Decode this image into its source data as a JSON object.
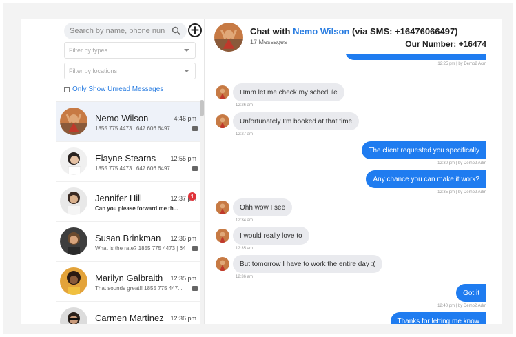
{
  "search": {
    "placeholder": "Search by name, phone nun"
  },
  "filters": {
    "types_placeholder": "Filter by types",
    "locations_placeholder": "Filter by locations"
  },
  "unread_label": "Only Show Unread Messages",
  "contacts": [
    {
      "name": "Nemo Wilson",
      "time": "4:46 pm",
      "sub": "1855 775 4473 | 647 606 6497",
      "bold": false,
      "badge": ""
    },
    {
      "name": "Elayne Stearns",
      "time": "12:55 pm",
      "sub": "1855 775 4473 | 647 606 6497",
      "bold": false,
      "badge": ""
    },
    {
      "name": "Jennifer Hill",
      "time": "12:37 pm",
      "sub": "Can you please forward me th...",
      "bold": true,
      "badge": "1"
    },
    {
      "name": "Susan Brinkman",
      "time": "12:36 pm",
      "sub": "What is the rate? 1855 775 4473 | 64",
      "bold": false,
      "badge": ""
    },
    {
      "name": "Marilyn Galbraith",
      "time": "12:35 pm",
      "sub": "That sounds great!! 1855 775 447...",
      "bold": false,
      "badge": ""
    },
    {
      "name": "Carmen Martinez",
      "time": "12:36 pm",
      "sub": "",
      "bold": false,
      "badge": ""
    }
  ],
  "chat": {
    "title_prefix": "Chat with ",
    "title_name": "Nemo Wilson",
    "title_suffix": " (via SMS: +16476066497)",
    "message_count": "17 Messages",
    "our_number": "Our Number: +16474"
  },
  "messages": [
    {
      "dir": "out",
      "text": "",
      "meta": "12:25 pm | by Demo2 Acm"
    },
    {
      "dir": "in",
      "text": "Hmm let me check my schedule",
      "meta": "12:26 am"
    },
    {
      "dir": "in",
      "text": "Unfortunately I'm booked at that time",
      "meta": "12:27 am"
    },
    {
      "dir": "out",
      "text": "The client requested you specifically",
      "meta": "12:30 pm | by Demo2 Adm"
    },
    {
      "dir": "out",
      "text": "Any chance you can make it work?",
      "meta": "12:35 pm | by Demo2 Adm"
    },
    {
      "dir": "in",
      "text": "Ohh wow I see",
      "meta": "12:34 am"
    },
    {
      "dir": "in",
      "text": "I would really love to",
      "meta": "12:35 am"
    },
    {
      "dir": "in",
      "text": "But tomorrow I have to work the entire day :(",
      "meta": "12:36 am"
    },
    {
      "dir": "out",
      "text": "Got it",
      "meta": "12:40 pm | by Demo2 Adm"
    },
    {
      "dir": "out",
      "text": "Thanks for letting me know",
      "meta": ""
    }
  ],
  "colors": {
    "accent": "#1f7cf0",
    "link": "#2a7de1",
    "incoming_bubble": "#e9eaee",
    "badge": "#e0333a",
    "active_row": "#eef2f9"
  },
  "icons": {
    "search": "search-icon",
    "add": "plus-circle-icon",
    "sms": "sms-icon",
    "dropdown": "chevron-down-icon"
  }
}
